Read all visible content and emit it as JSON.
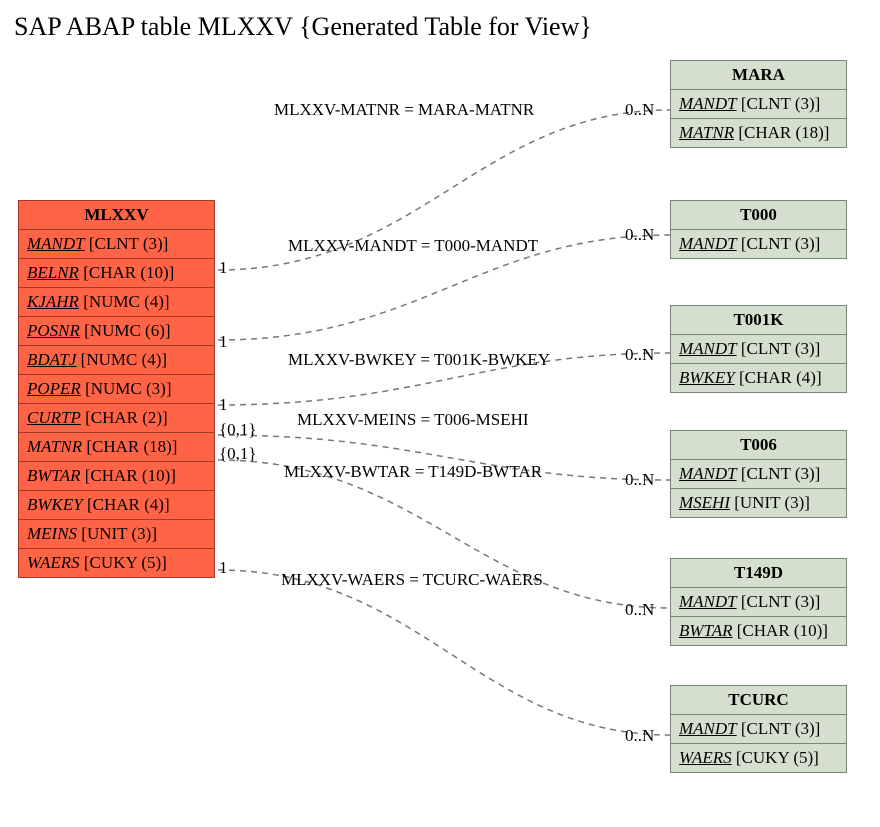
{
  "title": "SAP ABAP table MLXXV {Generated Table for View}",
  "main_table": {
    "name": "MLXXV",
    "fields": [
      {
        "name": "MANDT",
        "type": "[CLNT (3)]",
        "underline": true
      },
      {
        "name": "BELNR",
        "type": "[CHAR (10)]",
        "underline": true
      },
      {
        "name": "KJAHR",
        "type": "[NUMC (4)]",
        "underline": true
      },
      {
        "name": "POSNR",
        "type": "[NUMC (6)]",
        "underline": true
      },
      {
        "name": "BDATJ",
        "type": "[NUMC (4)]",
        "underline": true
      },
      {
        "name": "POPER",
        "type": "[NUMC (3)]",
        "underline": true
      },
      {
        "name": "CURTP",
        "type": "[CHAR (2)]",
        "underline": true
      },
      {
        "name": "MATNR",
        "type": "[CHAR (18)]",
        "underline": false
      },
      {
        "name": "BWTAR",
        "type": "[CHAR (10)]",
        "underline": false
      },
      {
        "name": "BWKEY",
        "type": "[CHAR (4)]",
        "underline": false
      },
      {
        "name": "MEINS",
        "type": "[UNIT (3)]",
        "underline": false
      },
      {
        "name": "WAERS",
        "type": "[CUKY (5)]",
        "underline": false
      }
    ]
  },
  "ref_tables": [
    {
      "name": "MARA",
      "fields": [
        {
          "name": "MANDT",
          "type": "[CLNT (3)]",
          "underline": true
        },
        {
          "name": "MATNR",
          "type": "[CHAR (18)]",
          "underline": true
        }
      ]
    },
    {
      "name": "T000",
      "fields": [
        {
          "name": "MANDT",
          "type": "[CLNT (3)]",
          "underline": true
        }
      ]
    },
    {
      "name": "T001K",
      "fields": [
        {
          "name": "MANDT",
          "type": "[CLNT (3)]",
          "underline": true
        },
        {
          "name": "BWKEY",
          "type": "[CHAR (4)]",
          "underline": true
        }
      ]
    },
    {
      "name": "T006",
      "fields": [
        {
          "name": "MANDT",
          "type": "[CLNT (3)]",
          "underline": true
        },
        {
          "name": "MSEHI",
          "type": "[UNIT (3)]",
          "underline": true
        }
      ]
    },
    {
      "name": "T149D",
      "fields": [
        {
          "name": "MANDT",
          "type": "[CLNT (3)]",
          "underline": true
        },
        {
          "name": "BWTAR",
          "type": "[CHAR (10)]",
          "underline": true
        }
      ]
    },
    {
      "name": "TCURC",
      "fields": [
        {
          "name": "MANDT",
          "type": "[CLNT (3)]",
          "underline": true
        },
        {
          "name": "WAERS",
          "type": "[CUKY (5)]",
          "underline": true
        }
      ]
    }
  ],
  "relations": [
    {
      "label": "MLXXV-MATNR = MARA-MATNR",
      "left_card": "1",
      "right_card": "0..N"
    },
    {
      "label": "MLXXV-MANDT = T000-MANDT",
      "left_card": "1",
      "right_card": "0..N"
    },
    {
      "label": "MLXXV-BWKEY = T001K-BWKEY",
      "left_card": "1",
      "right_card": "0..N"
    },
    {
      "label": "MLXXV-MEINS = T006-MSEHI",
      "left_card": "{0,1}",
      "right_card": "0..N"
    },
    {
      "label": "MLXXV-BWTAR = T149D-BWTAR",
      "left_card": "{0,1}",
      "right_card": "0..N"
    },
    {
      "label": "MLXXV-WAERS = TCURC-WAERS",
      "left_card": "1",
      "right_card": "0..N"
    }
  ]
}
